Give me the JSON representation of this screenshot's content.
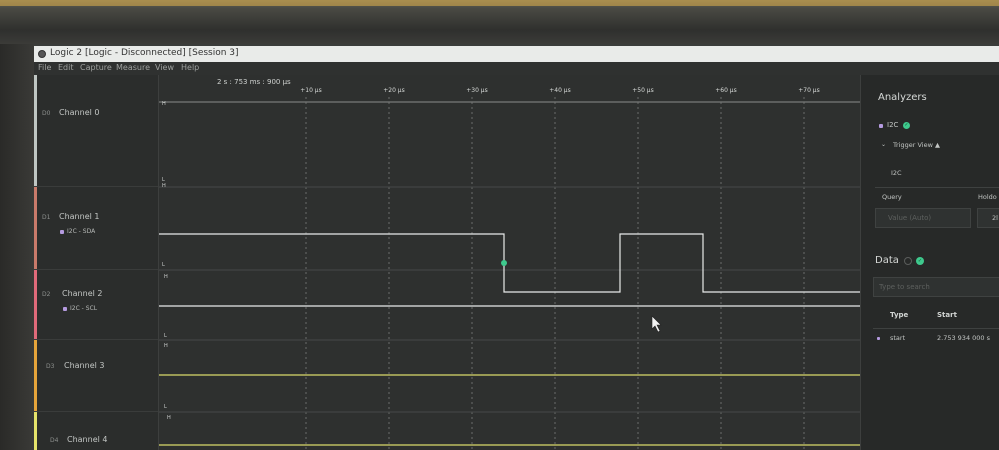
{
  "window": {
    "title": "Logic 2 [Logic - Disconnected] [Session 3]"
  },
  "menu": [
    "File",
    "Edit",
    "Capture",
    "Measure",
    "View",
    "Help"
  ],
  "timeline": {
    "timestamp": "2 s : 753 ms : 900 μs",
    "ticks": [
      "+10 μs",
      "+20 μs",
      "+30 μs",
      "+40 μs",
      "+50 μs",
      "+60 μs",
      "+70 μs"
    ]
  },
  "channels": [
    {
      "index": "D0",
      "name": "Channel 0",
      "analyzer": "",
      "color": "#bfc6c3"
    },
    {
      "index": "D1",
      "name": "Channel 1",
      "analyzer": "I2C - SDA",
      "color": "#c97a6a"
    },
    {
      "index": "D2",
      "name": "Channel 2",
      "analyzer": "I2C - SCL",
      "color": "#e06a7a"
    },
    {
      "index": "D3",
      "name": "Channel 3",
      "analyzer": "",
      "color": "#e6a43a"
    },
    {
      "index": "D4",
      "name": "Channel 4",
      "analyzer": "",
      "color": "#e5e36a"
    }
  ],
  "levels": {
    "high": "H",
    "low": "L"
  },
  "panel": {
    "analyzers_title": "Analyzers",
    "analyzer_name": "I2C",
    "trigger_view": "Trigger View ▲",
    "trigger_analyzer": "I2C",
    "query_label": "Query",
    "holdoff_label": "Holdo",
    "query_placeholder": "Value (Auto)",
    "holdoff_value": "2l",
    "data_title": "Data",
    "search_placeholder": "Type to search",
    "table_headers": [
      "Type",
      "Start"
    ],
    "rows": [
      {
        "type": "start",
        "start": "2.753 934 000 s"
      }
    ]
  },
  "colors": {
    "accent_green": "#3ec98d",
    "analyzer_purple": "#b59be0",
    "trace_white": "#e8eae9",
    "trace_yellow": "#d9d96a"
  },
  "icons": [
    "app-icon",
    "check-icon",
    "chevron-down-icon",
    "mouse-cursor-icon"
  ]
}
